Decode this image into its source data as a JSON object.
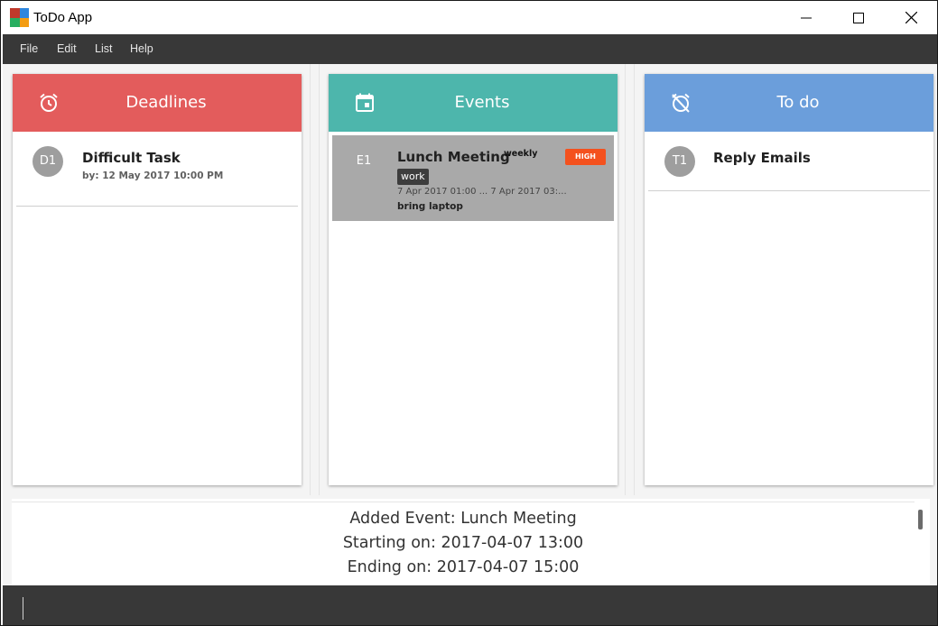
{
  "window": {
    "title": "ToDo App",
    "controls": [
      "minimize",
      "maximize",
      "close"
    ]
  },
  "menu": {
    "items": [
      "File",
      "Edit",
      "List",
      "Help"
    ]
  },
  "panels": {
    "deadlines": {
      "title": "Deadlines",
      "icon": "alarm-clock-icon",
      "color": "#e35c5c",
      "items": [
        {
          "id": "D1",
          "name": "Difficult Task",
          "detail": "by: 12 May 2017 10:00 PM"
        }
      ]
    },
    "events": {
      "title": "Events",
      "icon": "calendar-icon",
      "color": "#4db6ac",
      "items": [
        {
          "id": "E1",
          "name": "Lunch Meeting",
          "frequency": "weekly",
          "priority": "HIGH",
          "tag": "work",
          "start": "7 Apr 2017 01:00 ...",
          "end": "7 Apr 2017 03:...",
          "note": "bring laptop"
        }
      ]
    },
    "todo": {
      "title": "To do",
      "icon": "alarm-off-icon",
      "color": "#6b9edb",
      "items": [
        {
          "id": "T1",
          "name": "Reply Emails"
        }
      ]
    }
  },
  "result": {
    "lines": [
      "Added Event: Lunch Meeting",
      "Starting on: 2017-04-07 13:00",
      "Ending on: 2017-04-07 15:00"
    ]
  },
  "command": {
    "value": ""
  }
}
